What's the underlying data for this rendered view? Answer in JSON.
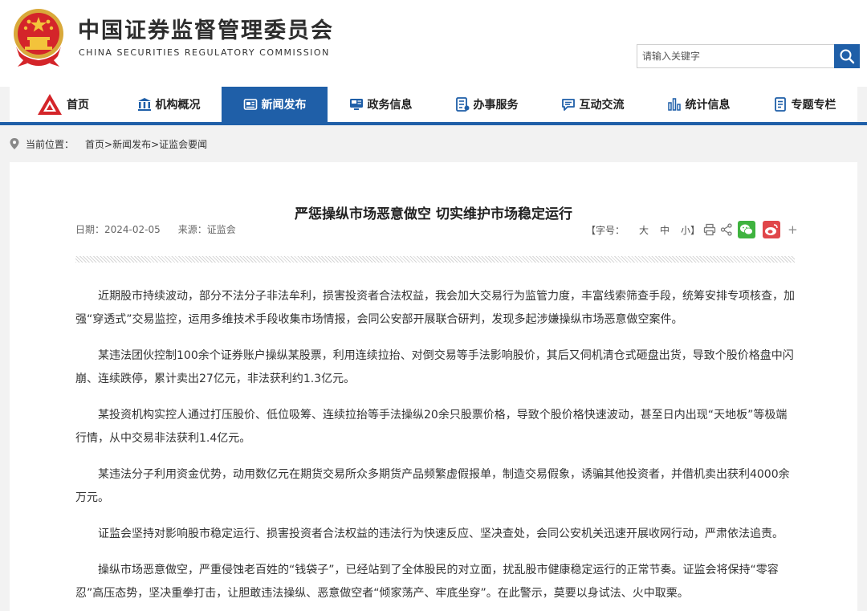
{
  "header": {
    "site_name_cn": "中国证券监督管理委员会",
    "site_name_en": "CHINA SECURITIES REGULATORY COMMISSION",
    "search_placeholder": "请输入关键字",
    "emblem_icon": "national-emblem-icon",
    "search_icon": "search-icon"
  },
  "nav": {
    "items": [
      {
        "label": "首页",
        "icon": "csrc-logo-icon",
        "active": false
      },
      {
        "label": "机构概况",
        "icon": "building-icon",
        "active": false
      },
      {
        "label": "新闻发布",
        "icon": "newspaper-icon",
        "active": true
      },
      {
        "label": "政务信息",
        "icon": "monitor-icon",
        "active": false
      },
      {
        "label": "办事服务",
        "icon": "document-list-icon",
        "active": false
      },
      {
        "label": "互动交流",
        "icon": "chat-icon",
        "active": false
      },
      {
        "label": "统计信息",
        "icon": "bar-chart-icon",
        "active": false
      },
      {
        "label": "专题专栏",
        "icon": "notebook-icon",
        "active": false
      }
    ]
  },
  "breadcrumb": {
    "label": "当前位置：",
    "trail": "首页>新闻发布>证监会要闻"
  },
  "article": {
    "title": "严惩操纵市场恶意做空 切实维护市场稳定运行",
    "date": "日期：2024-02-05",
    "source": "来源：证监会",
    "font_size_label": "【字号：",
    "font_large": "大",
    "font_medium": "中",
    "font_small": "小】",
    "paragraphs": [
      "近期股市持续波动，部分不法分子非法牟利，损害投资者合法权益，我会加大交易行为监管力度，丰富线索筛查手段，统筹安排专项核查，加强“穿透式”交易监控，运用多维技术手段收集市场情报，会同公安部开展联合研判，发现多起涉嫌操纵市场恶意做空案件。",
      "某违法团伙控制100余个证券账户操纵某股票，利用连续拉抬、对倒交易等手法影响股价，其后又伺机清仓式砸盘出货，导致个股价格盘中闪崩、连续跌停，累计卖出27亿元，非法获利约1.3亿元。",
      "某投资机构实控人通过打压股价、低位吸筹、连续拉抬等手法操纵20余只股票价格，导致个股价格快速波动，甚至日内出现“天地板”等极端行情，从中交易非法获利1.4亿元。",
      "某违法分子利用资金优势，动用数亿元在期货交易所众多期货产品频繁虚假报单，制造交易假象，诱骗其他投资者，并借机卖出获利4000余万元。",
      "证监会坚持对影响股市稳定运行、损害投资者合法权益的违法行为快速反应、坚决查处，会同公安机关迅速开展收网行动，严肃依法追责。",
      "操纵市场恶意做空，严重侵蚀老百姓的“钱袋子”，已经站到了全体股民的对立面，扰乱股市健康稳定运行的正常节奏。证监会将保持“零容忍”高压态势，坚决重拳打击，让胆敢违法操纵、恶意做空者“倾家荡产、牢底坐穿”。在此警示，莫要以身试法、火中取栗。"
    ]
  },
  "colors": {
    "brand_blue": "#1f5fa8",
    "emblem_red": "#d4252a",
    "wechat_green": "#3fb33f",
    "weibo_red": "#e0464a"
  }
}
